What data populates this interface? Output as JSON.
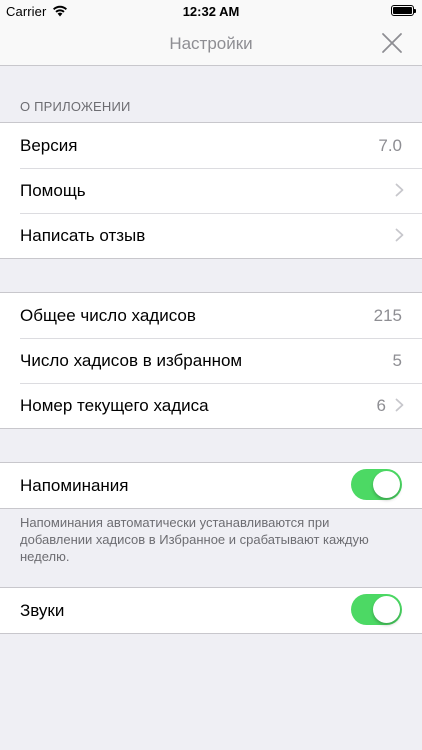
{
  "status_bar": {
    "carrier": "Carrier",
    "time": "12:32 AM"
  },
  "nav": {
    "title": "Настройки"
  },
  "about": {
    "header": "О ПРИЛОЖЕНИИ",
    "version_label": "Версия",
    "version_value": "7.0",
    "help_label": "Помощь",
    "review_label": "Написать отзыв"
  },
  "stats": {
    "total_label": "Общее число хадисов",
    "total_value": "215",
    "favorites_label": "Число хадисов в избранном",
    "favorites_value": "5",
    "current_label": "Номер текущего хадиса",
    "current_value": "6"
  },
  "reminders": {
    "label": "Напоминания",
    "enabled": true,
    "note": "Напоминания автоматически устанавливаются при добавлении хадисов в Избранное и срабатывают каждую неделю."
  },
  "sounds": {
    "label": "Звуки",
    "enabled": true
  },
  "colors": {
    "toggle_on": "#4cd964",
    "background": "#efeff4",
    "secondary_text": "#8e8e93"
  }
}
